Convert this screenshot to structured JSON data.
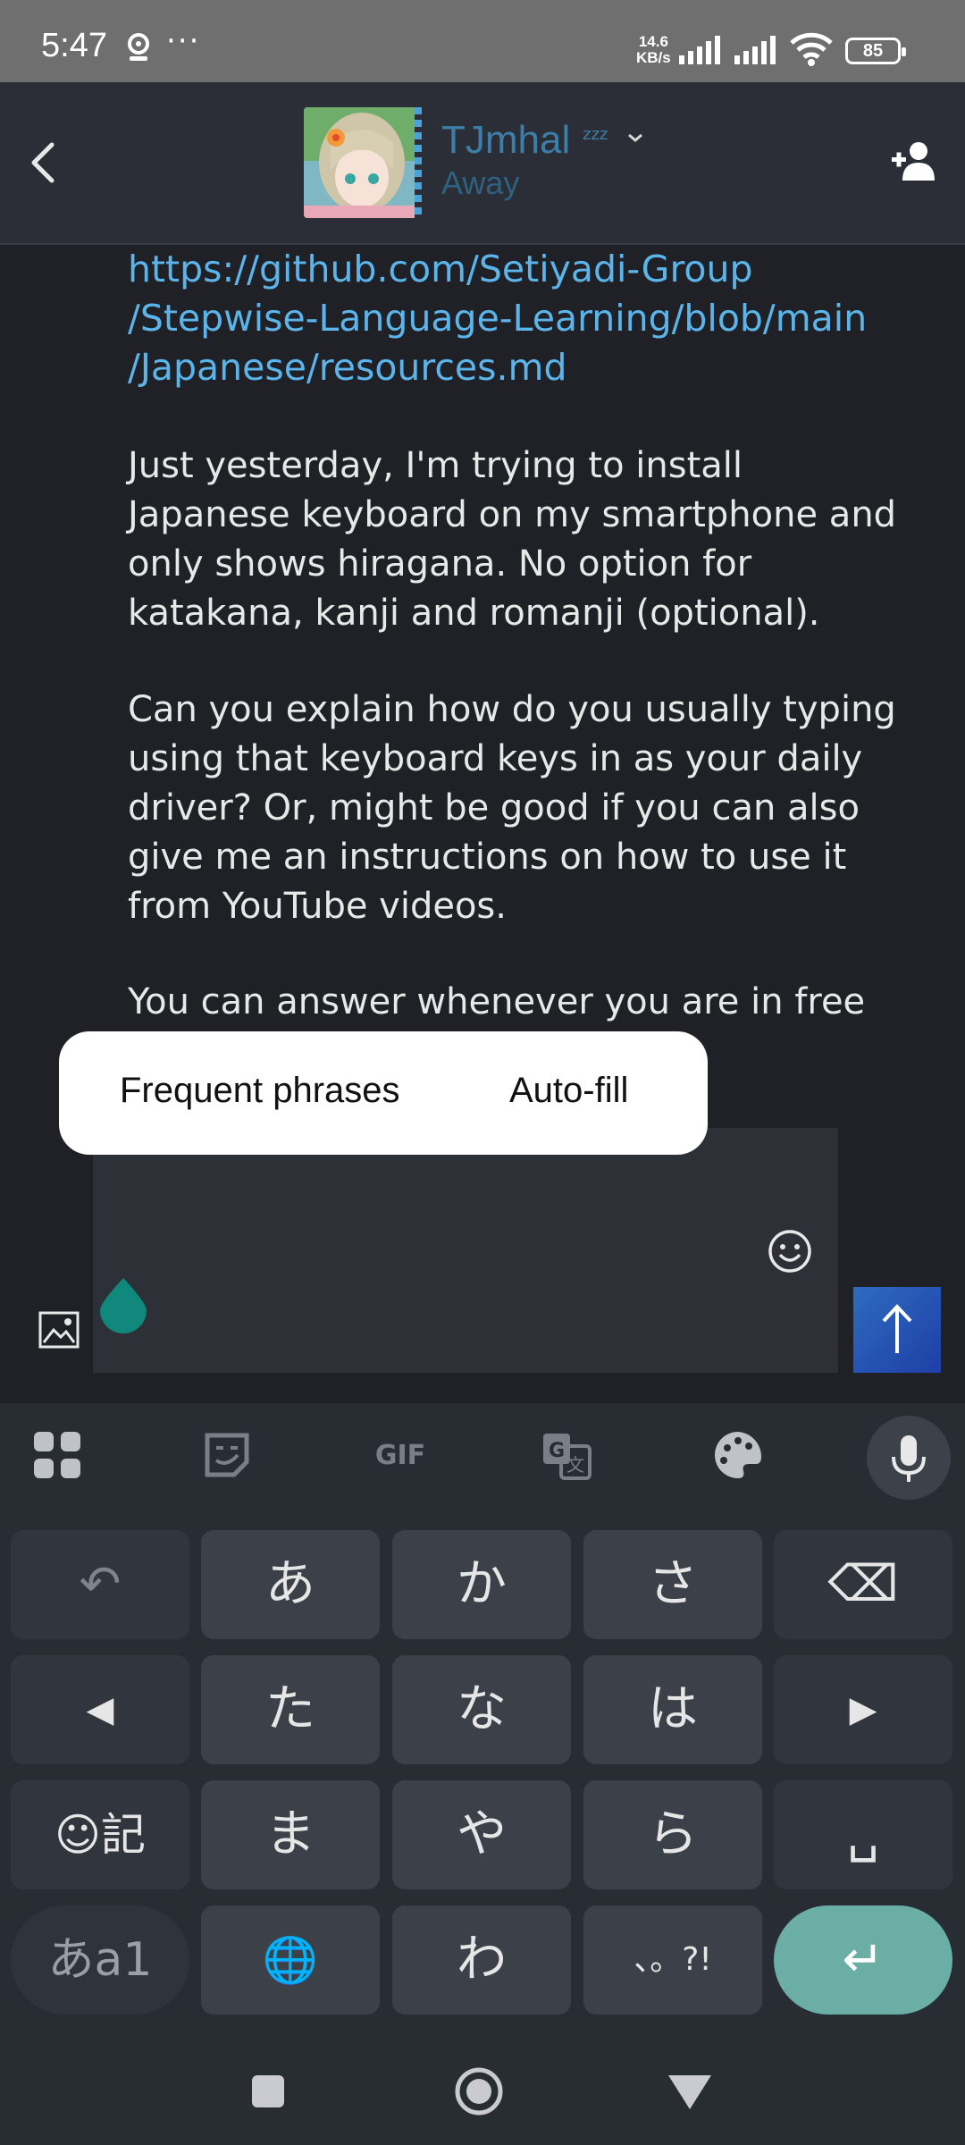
{
  "status_bar": {
    "time": "5:47",
    "dots": "···",
    "speed_value": "14.6",
    "speed_unit": "KB/s",
    "battery": "85"
  },
  "header": {
    "contact_name": "TJmhal",
    "zzz": "zzz",
    "contact_status": "Away"
  },
  "messages": {
    "link": "https://github.com/Setiyadi-Group/Stepwise-Language-Learning/blob/main/Japanese/resources.md",
    "link_lines": [
      "https://github.com/Setiyadi-Group",
      "/Stepwise-Language-Learning/blob/main",
      "/Japanese/resources.md"
    ],
    "paragraph_1": "Just yesterday, I'm trying to install Japanese keyboard on my smartphone and only shows hiragana. No option for katakana, kanji and romanji (optional).",
    "paragraph_2": "Can you explain how do you usually typing using that keyboard keys in as your daily driver?  Or, might be good if you can also give me an instructions on how to use it from YouTube videos.",
    "paragraph_3": "You can answer whenever you are in free"
  },
  "popup": {
    "item_1": "Frequent phrases",
    "item_2": "Auto-fill"
  },
  "keyboard": {
    "toolbar_gif": "GIF",
    "rows": [
      [
        "↶",
        "あ",
        "か",
        "さ",
        "⌫"
      ],
      [
        "◀",
        "た",
        "な",
        "は",
        "▶"
      ],
      [
        "☺記",
        "ま",
        "や",
        "ら",
        "␣"
      ],
      [
        "あa1",
        "🌐",
        "わ",
        "、。?!",
        "↵"
      ]
    ]
  },
  "colors": {
    "link": "#5bb4ea",
    "accent_teal": "#6aaea6",
    "send_button": "#2d6bc0",
    "contact_name": "#3b7fa8"
  },
  "icons": {
    "back": "chevron-left-icon",
    "add_friend": "add-user-icon",
    "emoji": "smiley-icon",
    "image": "image-icon",
    "send": "arrow-up-icon",
    "mic": "mic-icon"
  }
}
